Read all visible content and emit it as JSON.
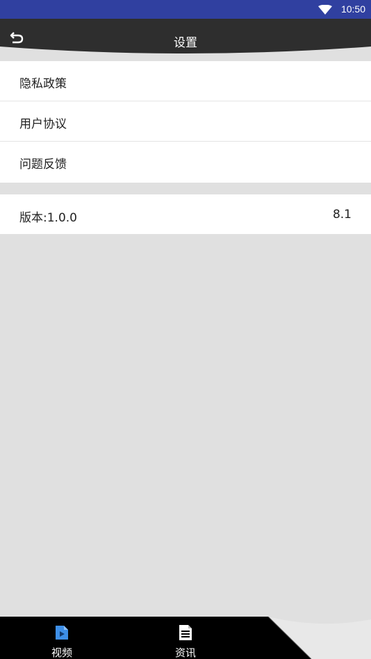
{
  "status_bar": {
    "time": "10:50",
    "wifi_icon": "wifi-icon"
  },
  "app_bar": {
    "title": "设置",
    "back_icon": "back-arrow-icon"
  },
  "settings_group": [
    {
      "label": "隐私政策"
    },
    {
      "label": "用户协议"
    },
    {
      "label": "问题反馈"
    }
  ],
  "version_row": {
    "label": "版本:1.0.0",
    "value": "8.1"
  },
  "bottom_nav": {
    "tabs": [
      {
        "label": "视频",
        "icon": "video-file-icon",
        "active": true,
        "color": "#3d8fe8"
      },
      {
        "label": "资讯",
        "icon": "document-icon",
        "active": false,
        "color": "#ffffff"
      }
    ]
  },
  "colors": {
    "status_bar": "#3040a0",
    "app_bar": "#2e2e2e",
    "background": "#e0e0e0",
    "bottom_bar": "#000000",
    "accent": "#3d8fe8"
  }
}
